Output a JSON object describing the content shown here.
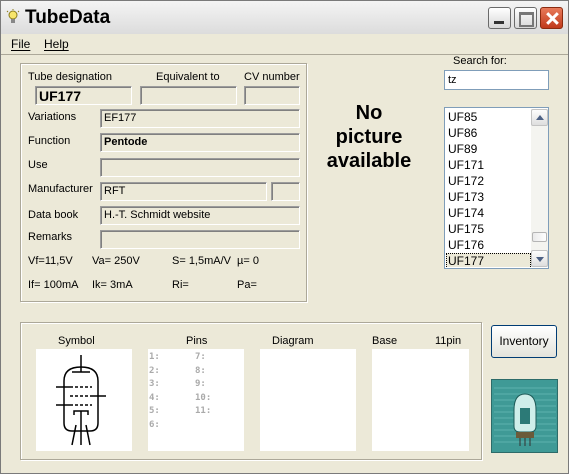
{
  "window": {
    "title": "TubeData"
  },
  "menu": {
    "file": "File",
    "help": "Help"
  },
  "details": {
    "tube_designation_label": "Tube designation",
    "equivalent_label": "Equivalent to",
    "cv_label": "CV number",
    "tube_designation": "UF177",
    "equivalent": "",
    "cv_number": "",
    "variations_label": "Variations",
    "variations": "EF177",
    "function_label": "Function",
    "function": "Pentode",
    "use_label": "Use",
    "use": "",
    "manufacturer_label": "Manufacturer",
    "manufacturer": "RFT",
    "manufacturer_extra": "",
    "data_book_label": "Data book",
    "data_book": "H.-T. Schmidt website",
    "remarks_label": "Remarks",
    "remarks": "",
    "vf": "Vf=11,5V",
    "va": "Va= 250V",
    "s": "S= 1,5mA/V",
    "mu": "µ= 0",
    "if": "If= 100mA",
    "ik": "Ik= 3mA",
    "ri": "Ri=",
    "pa": "Pa="
  },
  "no_picture": [
    "No",
    "picture",
    "available"
  ],
  "search": {
    "label": "Search for:",
    "value": "tz"
  },
  "tube_list": {
    "items": [
      "UF85",
      "UF86",
      "UF89",
      "UF171",
      "UF172",
      "UF173",
      "UF174",
      "UF175",
      "UF176",
      "UF177"
    ],
    "selected": "UF177"
  },
  "bottom": {
    "symbol_label": "Symbol",
    "pins_label": "Pins",
    "diagram_label": "Diagram",
    "base_label": "Base",
    "base_value": "11pin",
    "pins_left": [
      "1:",
      "2:",
      "3:",
      "4:",
      "5:",
      "6:"
    ],
    "pins_right": [
      "7:",
      "8:",
      "9:",
      "10:",
      "11:"
    ]
  },
  "inventory_button": "Inventory",
  "colors": {
    "selection": "#ece9d8",
    "logo": "#3f9a96"
  }
}
